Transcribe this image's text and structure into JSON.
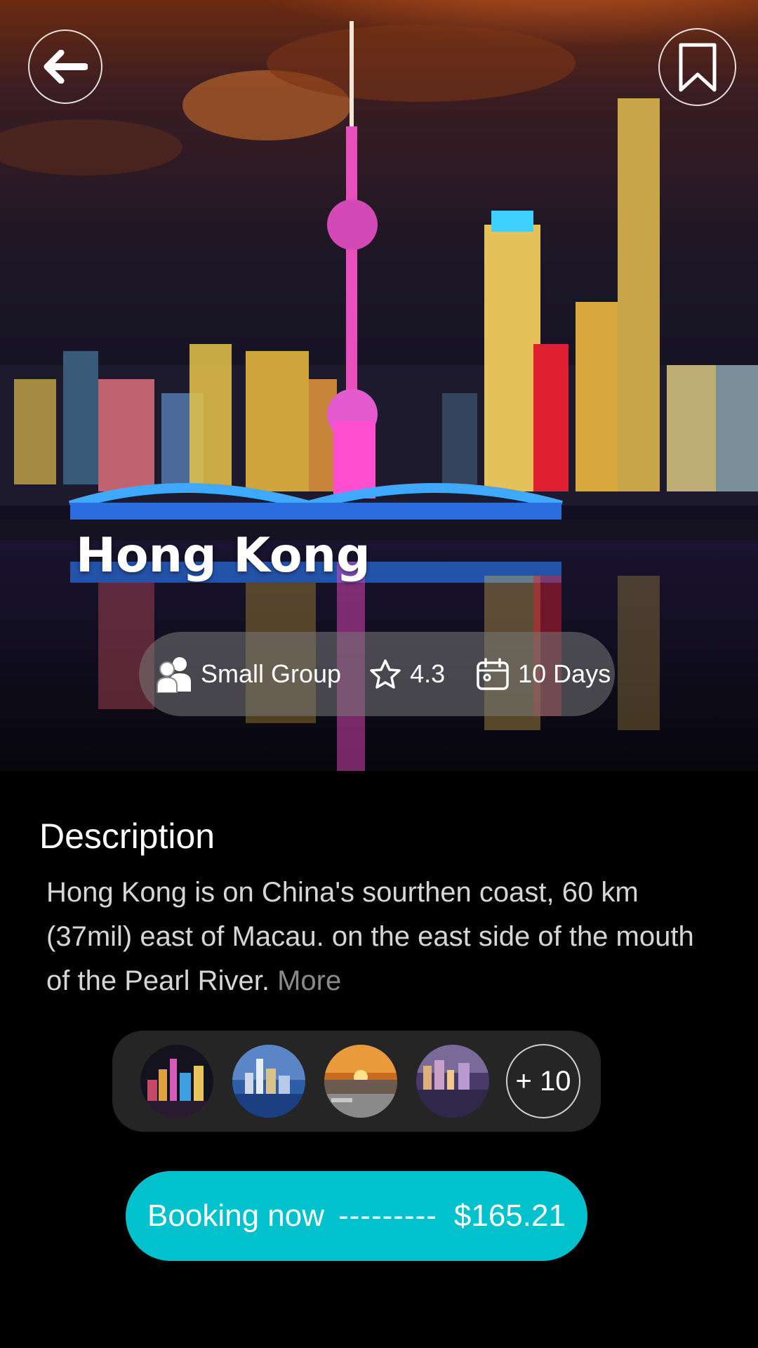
{
  "hero": {
    "title": "Hong Kong",
    "back_icon": "arrow-left-icon",
    "bookmark_icon": "bookmark-icon"
  },
  "info": {
    "group_icon": "users-icon",
    "group_label": "Small Group",
    "rating_icon": "star-icon",
    "rating": "4.3",
    "duration_icon": "calendar-icon",
    "duration": "10 Days"
  },
  "description": {
    "heading": "Description",
    "text": "Hong Kong is on China's sourthen coast, 60 km (37mil) east of Macau. on the east side of the mouth of the Pearl River.",
    "more_label": "More"
  },
  "gallery": {
    "thumbnails": [
      {
        "name": "city-night-photo"
      },
      {
        "name": "harbour-skyline-photo"
      },
      {
        "name": "sunset-bay-photo"
      },
      {
        "name": "waterfront-dusk-photo"
      }
    ],
    "more_count_label": "+ 10"
  },
  "booking": {
    "label": "Booking now",
    "separator": "---------",
    "price": "$165.21"
  },
  "colors": {
    "accent": "#00c1cc",
    "background": "#000000",
    "pill": "#787878",
    "gallery_bg": "#252525"
  }
}
